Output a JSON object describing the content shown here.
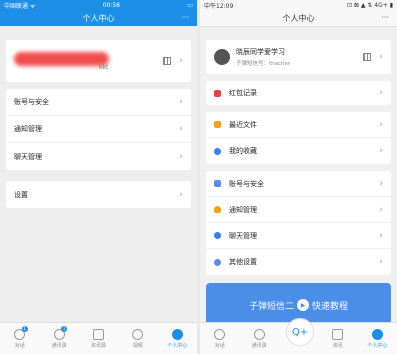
{
  "left": {
    "status": {
      "carrier": "中国联通 ᯤ",
      "time": "00:58",
      "battery": "▭"
    },
    "title": "个人中心",
    "more": "···",
    "profile": {
      "name_redacted": "",
      "id_hint": "kkt"
    },
    "group1": [
      {
        "label": "账号与安全"
      },
      {
        "label": "通知管理"
      },
      {
        "label": "聊天管理"
      }
    ],
    "group2": [
      {
        "label": "设置"
      }
    ],
    "tabs": [
      {
        "label": "对话",
        "badge": "1"
      },
      {
        "label": "通讯录",
        "badge": "1"
      },
      {
        "label": "资讯源"
      },
      {
        "label": "视频"
      },
      {
        "label": "个人中心"
      }
    ]
  },
  "right": {
    "status": {
      "left": "中午12:09",
      "right": "⊡ ⊠ ▲ ⇅ 4G+ ▮"
    },
    "title": "个人中心",
    "more": "···",
    "profile": {
      "name": "晓辰同学爱学习",
      "id": "子弹短信号：thacher"
    },
    "items": [
      {
        "label": "红包记录",
        "color": "#e64545"
      },
      {
        "label": "最近文件",
        "color": "#f0a020"
      },
      {
        "label": "我的收藏",
        "color": "#3a7ee6"
      },
      {
        "label": "账号与安全",
        "color": "#5b8de0"
      },
      {
        "label": "通知管理",
        "color": "#f0a020"
      },
      {
        "label": "聊天管理",
        "color": "#3a7ee6"
      },
      {
        "label": "其他设置",
        "color": "#5b8de0"
      }
    ],
    "banner": {
      "left": "子弹短信二",
      "right": "快速教程"
    },
    "tabs": [
      {
        "label": "对话"
      },
      {
        "label": "通讯录"
      },
      {
        "label": ""
      },
      {
        "label": "资讯"
      },
      {
        "label": "个人中心"
      }
    ],
    "center_icon": "Q+"
  }
}
